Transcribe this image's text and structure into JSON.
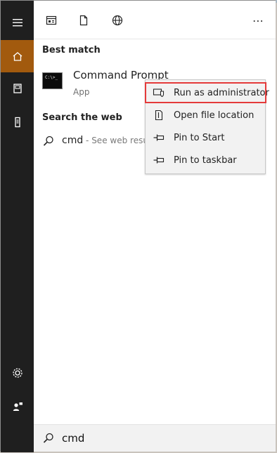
{
  "toolbar": {
    "icons": [
      "calendar-icon",
      "document-icon",
      "globe-icon"
    ],
    "more_label": "⋯"
  },
  "sections": {
    "best_match": "Best match",
    "search_web": "Search the web"
  },
  "best_match_item": {
    "title": "Command Prompt",
    "subtitle": "App",
    "icon_text": "C:\\>_"
  },
  "web_result": {
    "query": "cmd",
    "suffix": " - See web resu"
  },
  "context_menu": {
    "items": [
      {
        "label": "Run as administrator",
        "icon": "shield-icon",
        "highlighted": true
      },
      {
        "label": "Open file location",
        "icon": "file-location-icon",
        "highlighted": false
      },
      {
        "label": "Pin to Start",
        "icon": "pin-icon",
        "highlighted": false
      },
      {
        "label": "Pin to taskbar",
        "icon": "pin-icon",
        "highlighted": false
      }
    ]
  },
  "search": {
    "value": "cmd"
  },
  "colors": {
    "rail_bg": "#1f1f1f",
    "active_accent": "#a25a0e",
    "highlight_border": "#e43a3a"
  }
}
